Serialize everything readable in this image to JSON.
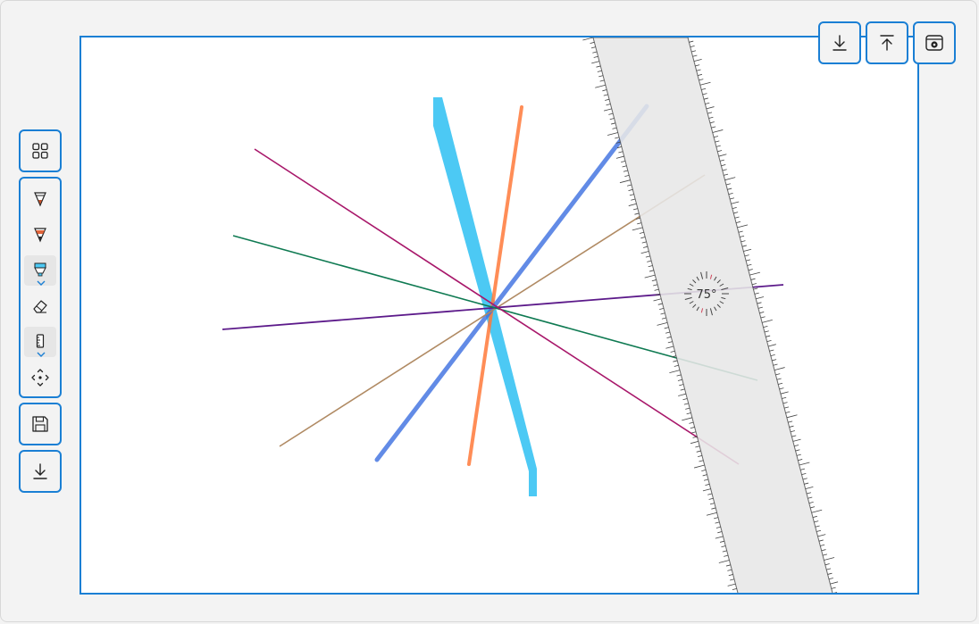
{
  "canvas": {
    "border_color": "#1a7fd4",
    "background": "#ffffff",
    "strokes": [
      {
        "name": "highlighter-cyan",
        "color": "#4cc9f4",
        "kind": "highlighter"
      },
      {
        "name": "ink-orange",
        "color": "#ff7a3a",
        "kind": "pencil"
      },
      {
        "name": "ink-blue",
        "color": "#3c6fe0",
        "kind": "pencil"
      },
      {
        "name": "ink-tan",
        "color": "#b08a63",
        "kind": "pen"
      },
      {
        "name": "ink-purple",
        "color": "#5c1a8a",
        "kind": "pen"
      },
      {
        "name": "ink-green",
        "color": "#0f7a52",
        "kind": "pen"
      },
      {
        "name": "ink-magenta",
        "color": "#a8176a",
        "kind": "pen"
      }
    ]
  },
  "ruler": {
    "angle_label": "75°",
    "tick_color": "#444444",
    "fill": "#e8e8e8"
  },
  "top_toolbar": {
    "icons": [
      "arrow-down-to-line-icon",
      "arrow-up-from-line-icon",
      "settings-gear-icon"
    ]
  },
  "left_toolbar": {
    "top_icon": "grid-four-squares-icon",
    "tools": [
      {
        "icon": "ballpoint-pen-icon",
        "selected": false,
        "has_menu": false
      },
      {
        "icon": "pencil-icon",
        "selected": false,
        "has_menu": false
      },
      {
        "icon": "highlighter-icon",
        "selected": true,
        "has_menu": true
      },
      {
        "icon": "eraser-icon",
        "selected": false,
        "has_menu": false
      },
      {
        "icon": "ruler-icon",
        "selected": true,
        "has_menu": true
      },
      {
        "icon": "lasso-select-icon",
        "selected": false,
        "has_menu": false
      }
    ],
    "save_icon": "save-icon",
    "download_icon": "arrow-down-to-line-icon"
  },
  "colors": {
    "accent": "#1a7fd4",
    "window_bg": "#f3f3f3"
  }
}
